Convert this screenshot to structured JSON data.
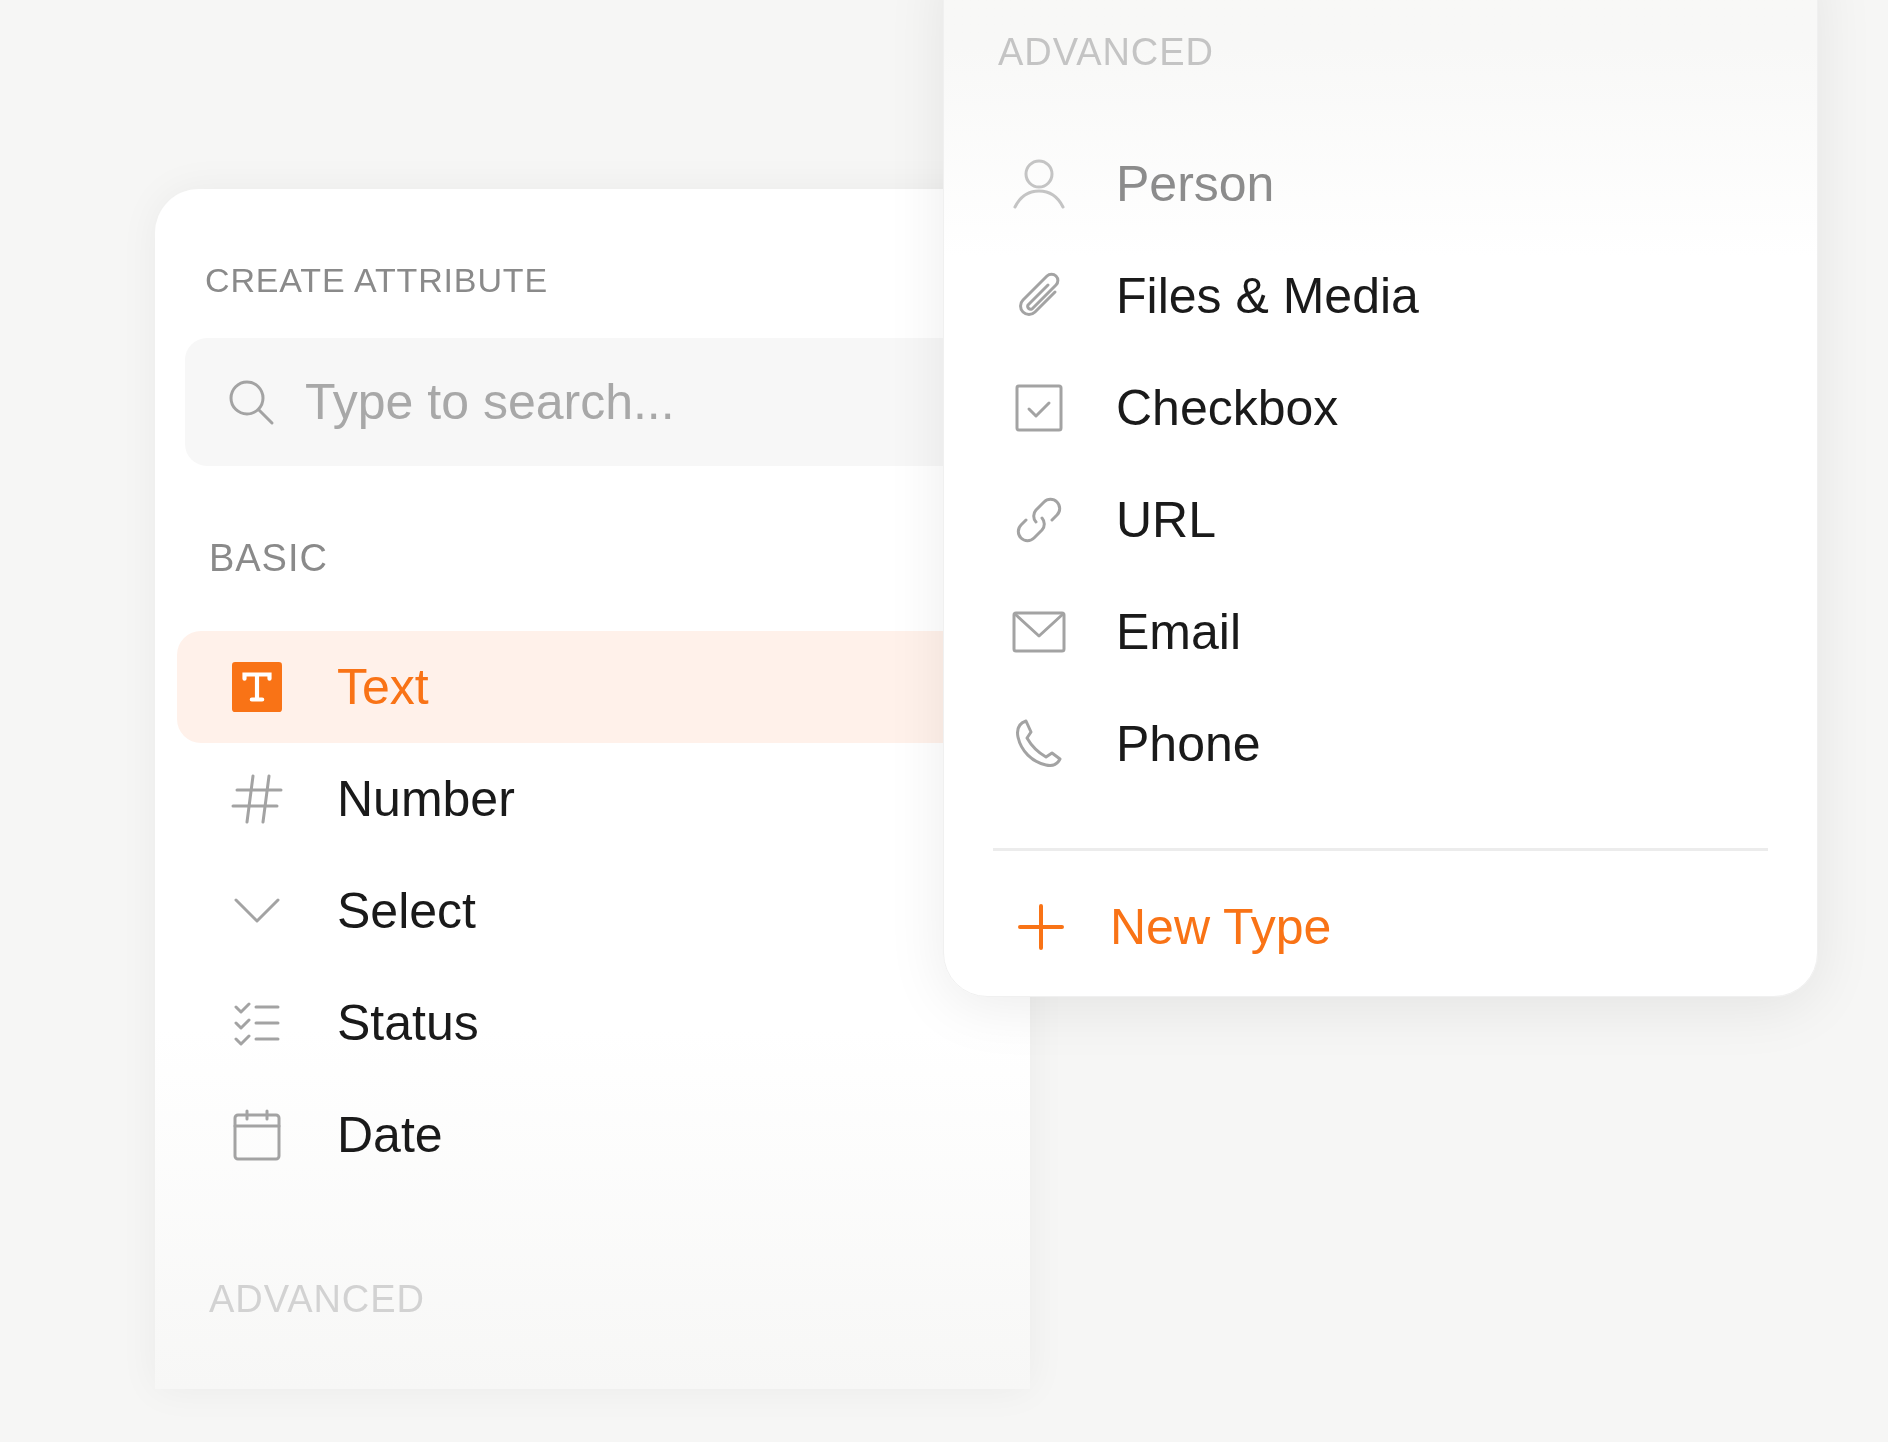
{
  "create_panel": {
    "title": "CREATE ATTRIBUTE",
    "search": {
      "placeholder": "Type to search..."
    },
    "sections": [
      {
        "heading": "BASIC",
        "faded": false,
        "items": [
          {
            "kind": "text",
            "label": "Text",
            "selected": true
          },
          {
            "kind": "number",
            "label": "Number",
            "selected": false
          },
          {
            "kind": "select",
            "label": "Select",
            "selected": false
          },
          {
            "kind": "status",
            "label": "Status",
            "selected": false
          },
          {
            "kind": "date",
            "label": "Date",
            "selected": false
          }
        ]
      },
      {
        "heading": "ADVANCED",
        "faded": true
      }
    ]
  },
  "type_menu": {
    "heading": "ADVANCED",
    "items": [
      {
        "kind": "person",
        "label": "Person",
        "faded": true
      },
      {
        "kind": "files",
        "label": "Files & Media",
        "faded": false
      },
      {
        "kind": "checkbox",
        "label": "Checkbox",
        "faded": false
      },
      {
        "kind": "url",
        "label": "URL",
        "faded": false
      },
      {
        "kind": "email",
        "label": "Email",
        "faded": false
      },
      {
        "kind": "phone",
        "label": "Phone",
        "faded": false
      }
    ],
    "new_button": {
      "label": "New Type"
    }
  }
}
